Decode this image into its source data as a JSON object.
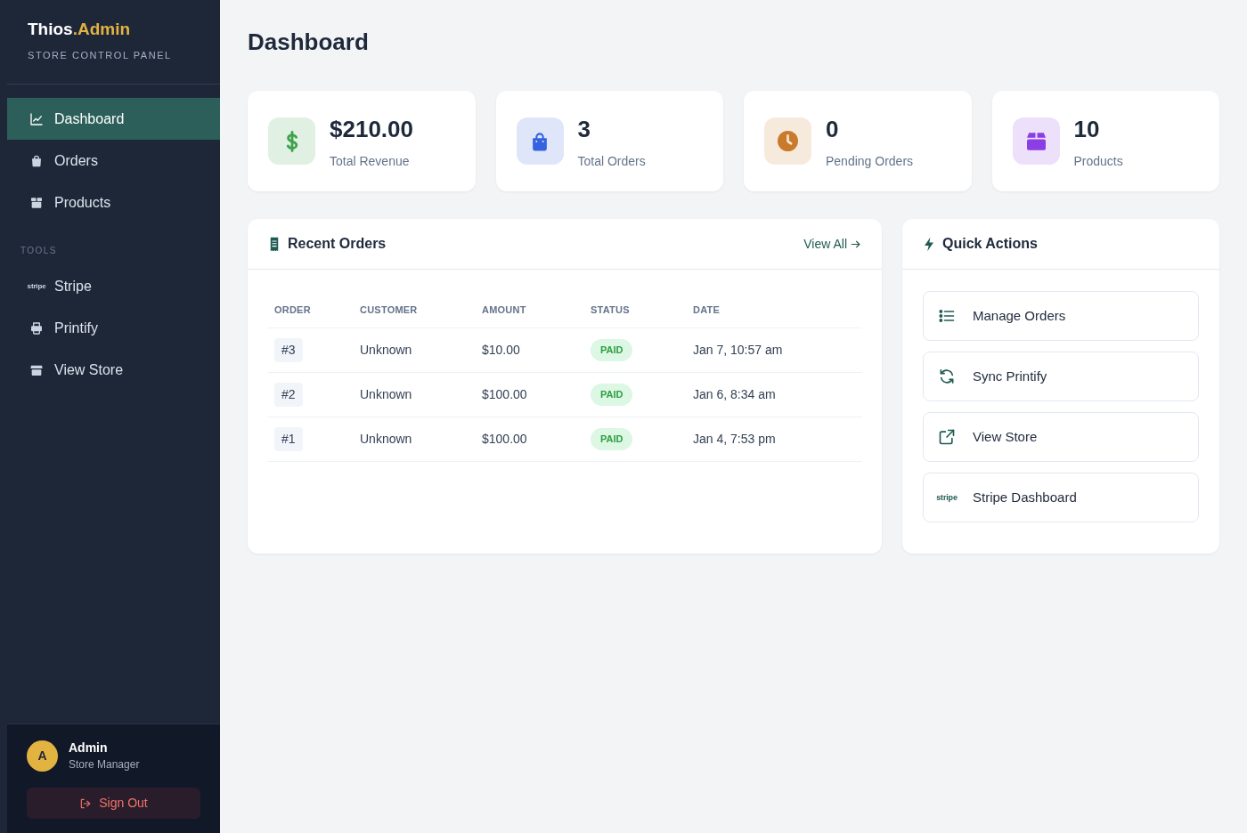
{
  "sidebar": {
    "brand": {
      "name": "Thios",
      "accent": ".Admin"
    },
    "subtitle": "STORE CONTROL PANEL",
    "nav_items": [
      {
        "label": "Dashboard",
        "selected": true
      },
      {
        "label": "Orders",
        "selected": false
      },
      {
        "label": "Products",
        "selected": false
      }
    ],
    "tools_heading": "TOOLS",
    "tool_items": [
      {
        "label": "Stripe",
        "logo_text": "stripe",
        "selected": false
      },
      {
        "label": "Printify",
        "selected": false
      },
      {
        "label": "View Store",
        "selected": false
      }
    ],
    "user": {
      "initial": "A",
      "name": "Admin",
      "role": "Store Manager"
    },
    "sign_out": "Sign Out"
  },
  "page_title": "Dashboard",
  "stats": [
    {
      "value": "$210.00",
      "label": "Total Revenue",
      "color": "#3fa34d"
    },
    {
      "value": "3",
      "label": "Total Orders",
      "color": "#3563e0"
    },
    {
      "value": "0",
      "label": "Pending Orders",
      "color": "#c97a2b"
    },
    {
      "value": "10",
      "label": "Products",
      "color": "#8b3ee3"
    }
  ],
  "recent_orders": {
    "title": "Recent Orders",
    "view_all": "View All",
    "table": {
      "columns": [
        "ORDER",
        "CUSTOMER",
        "AMOUNT",
        "STATUS",
        "DATE"
      ],
      "rows": [
        {
          "order": "#3",
          "customer": "Unknown",
          "amount": "$10.00",
          "status": "PAID",
          "date": "Jan 7, 10:57 am"
        },
        {
          "order": "#2",
          "customer": "Unknown",
          "amount": "$100.00",
          "status": "PAID",
          "date": "Jan 6, 8:34 am"
        },
        {
          "order": "#1",
          "customer": "Unknown",
          "amount": "$100.00",
          "status": "PAID",
          "date": "Jan 4, 7:53 pm"
        }
      ]
    }
  },
  "quick_actions": {
    "title": "Quick Actions",
    "actions": [
      {
        "label": "Manage Orders"
      },
      {
        "label": "Sync Printify"
      },
      {
        "label": "View Store"
      },
      {
        "label": "Stripe Dashboard",
        "logo_text": "stripe"
      }
    ]
  }
}
